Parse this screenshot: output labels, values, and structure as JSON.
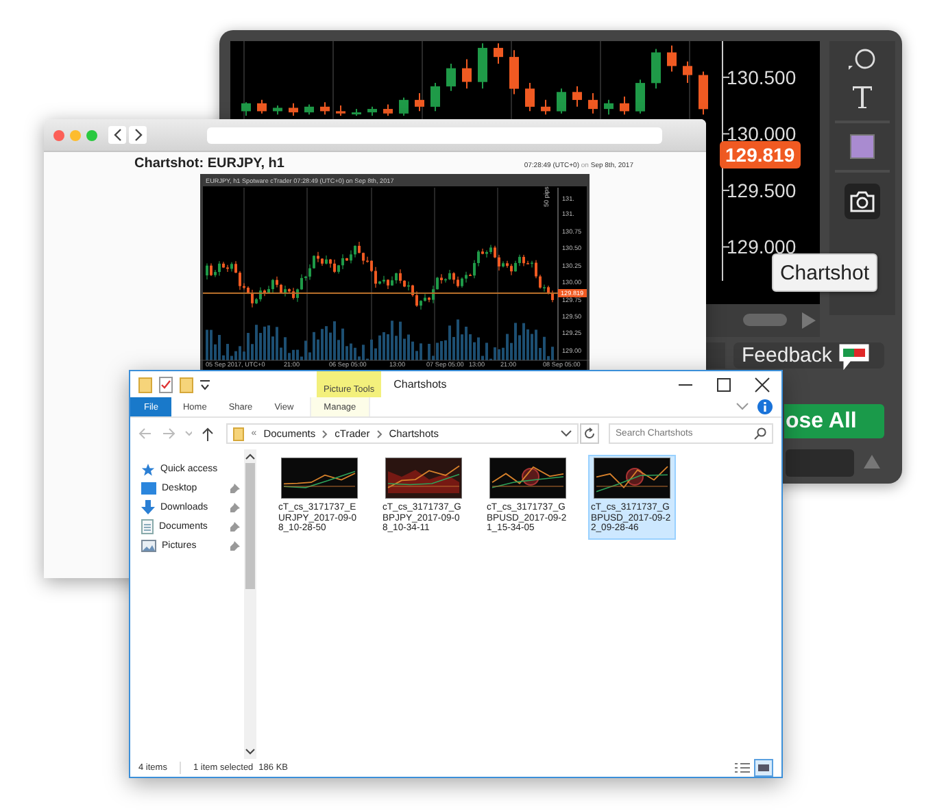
{
  "trading_platform": {
    "chart_data": {
      "type": "candlestick",
      "ohlc": [
        [
          130.2,
          130.28,
          130.16,
          130.27
        ],
        [
          130.27,
          130.3,
          130.18,
          130.2
        ],
        [
          130.2,
          130.25,
          130.17,
          130.23
        ],
        [
          130.23,
          130.27,
          130.16,
          130.19
        ],
        [
          130.19,
          130.26,
          130.17,
          130.24
        ],
        [
          130.24,
          130.28,
          130.17,
          130.2
        ],
        [
          130.2,
          130.25,
          130.16,
          130.18
        ],
        [
          130.18,
          130.22,
          130.16,
          130.19
        ],
        [
          130.19,
          130.24,
          130.16,
          130.22
        ],
        [
          130.22,
          130.26,
          130.16,
          130.18
        ],
        [
          130.18,
          130.32,
          130.16,
          130.3
        ],
        [
          130.3,
          130.36,
          130.2,
          130.24
        ],
        [
          130.24,
          130.45,
          130.2,
          130.42
        ],
        [
          130.42,
          130.62,
          130.38,
          130.58
        ],
        [
          130.58,
          130.66,
          130.4,
          130.46
        ],
        [
          130.46,
          130.8,
          130.4,
          130.76
        ],
        [
          130.76,
          130.8,
          130.62,
          130.68
        ],
        [
          130.68,
          130.74,
          130.35,
          130.4
        ],
        [
          130.4,
          130.45,
          130.2,
          130.24
        ],
        [
          130.24,
          130.3,
          130.17,
          130.2
        ],
        [
          130.2,
          130.4,
          130.18,
          130.37
        ],
        [
          130.37,
          130.42,
          130.24,
          130.3
        ],
        [
          130.3,
          130.36,
          130.18,
          130.22
        ],
        [
          130.22,
          130.3,
          130.17,
          130.27
        ],
        [
          130.27,
          130.33,
          130.17,
          130.2
        ],
        [
          130.2,
          130.48,
          130.18,
          130.45
        ],
        [
          130.45,
          130.75,
          130.4,
          130.72
        ],
        [
          130.72,
          130.78,
          130.55,
          130.6
        ],
        [
          130.6,
          130.64,
          130.45,
          130.52
        ],
        [
          130.52,
          130.55,
          130.17,
          130.22
        ]
      ],
      "ylim": [
        128.7,
        130.82
      ],
      "yticks": [
        {
          "value": 130.5,
          "label": "130.500"
        },
        {
          "value": 130.0,
          "label": "130.000"
        },
        {
          "value": 129.5,
          "label": "129.500"
        },
        {
          "value": 129.0,
          "label": "129.000"
        }
      ]
    },
    "current_price": "129.819",
    "tooltip": "Chartshot",
    "feedback_button": "Feedback",
    "close_all_button": "ose All"
  },
  "browser": {
    "page_title": "Chartshot: EURJPY, h1",
    "timestamp": {
      "time": "07:28:49 (UTC+0)",
      "joiner": "on",
      "date": "Sep 8th, 2017"
    },
    "chart": {
      "caption": "EURJPY, h1 Spotware cTrader 07:28:49 (UTC+0) on Sep 8th, 2017",
      "price_labels": [
        "131.",
        "131.",
        "130.75",
        "130.50",
        "130.25",
        "130.00",
        "129.75",
        "129.50",
        "129.25",
        "129.00"
      ],
      "current_price": "129.819",
      "range_label": "50 pips",
      "time_labels": [
        "05 Sep 2017, UTC+0",
        "21:00",
        "06 Sep 05:00",
        "13:00",
        "07 Sep 05:00",
        "13:00",
        "21:00",
        "08 Sep 05:00"
      ]
    }
  },
  "explorer": {
    "ribbon_context_tab": "Picture Tools",
    "title": "Chartshots",
    "ribbon_tabs": [
      {
        "label": "File",
        "selected": true
      },
      {
        "label": "Home",
        "selected": false
      },
      {
        "label": "Share",
        "selected": false
      },
      {
        "label": "View",
        "selected": false
      },
      {
        "label": "Manage",
        "selected": false
      }
    ],
    "breadcrumb_overflow": "«",
    "breadcrumb": [
      "Documents",
      "cTrader",
      "Chartshots"
    ],
    "search": {
      "placeholder": "Search Chartshots"
    },
    "nav_items": [
      {
        "label": "Quick access",
        "kind": "star",
        "pinned": false
      },
      {
        "label": "Desktop",
        "kind": "desktop",
        "pinned": true
      },
      {
        "label": "Downloads",
        "kind": "download",
        "pinned": true
      },
      {
        "label": "Documents",
        "kind": "document",
        "pinned": true
      },
      {
        "label": "Pictures",
        "kind": "pictures",
        "pinned": true
      }
    ],
    "files": [
      {
        "name": "cT_cs_3171737_EURJPY_2017-09-08_10-28-50",
        "selected": false
      },
      {
        "name": "cT_cs_3171737_GBPJPY_2017-09-08_10-34-11",
        "selected": false
      },
      {
        "name": "cT_cs_3171737_GBPUSD_2017-09-21_15-34-05",
        "selected": false
      },
      {
        "name": "cT_cs_3171737_GBPUSD_2017-09-22_09-28-46",
        "selected": true
      }
    ],
    "status_bar": {
      "item_count": "4 items",
      "selection": "1 item selected",
      "size": "186 KB"
    }
  }
}
